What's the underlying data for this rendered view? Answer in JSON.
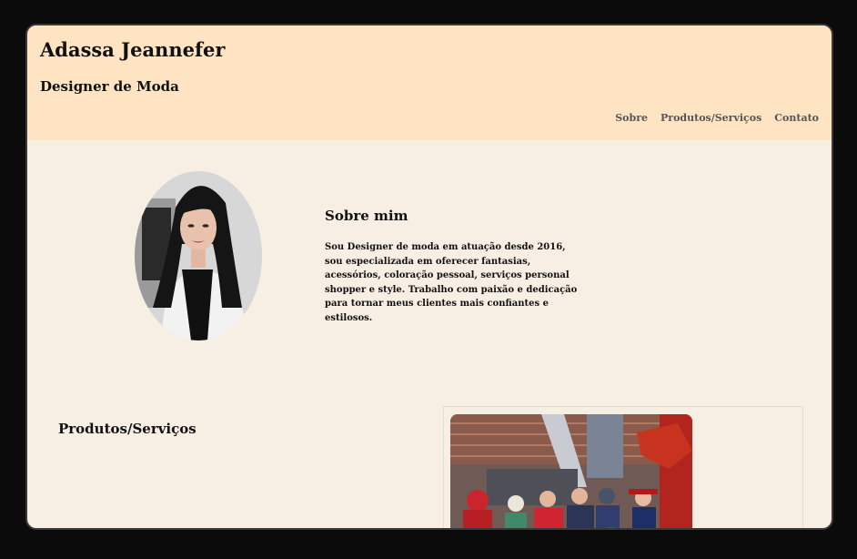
{
  "header": {
    "title": "Adassa Jeannefer",
    "subtitle": "Designer de Moda",
    "nav": [
      {
        "label": "Sobre"
      },
      {
        "label": "Produtos/Serviços"
      },
      {
        "label": "Contato"
      }
    ]
  },
  "about": {
    "heading": "Sobre mim",
    "text": "Sou Designer de moda em atuação desde 2016, sou especializada em oferecer fantasias, acessórios, coloração pessoal, serviços personal shopper e style. Trabalho com paixão e dedicação para tornar meus clientes mais confiantes e estilosos."
  },
  "products": {
    "heading": "Produtos/Serviços"
  },
  "colors": {
    "header_bg": "#ffe4c4",
    "page_bg": "#f8efe4",
    "frame_bg": "#0b0b0b"
  }
}
